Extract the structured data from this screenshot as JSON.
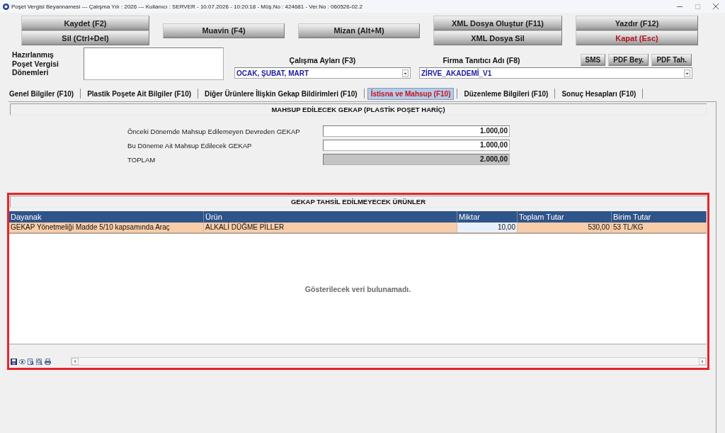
{
  "window": {
    "title": "Poşet Vergisi Beyannamesi --- Çalışma Yılı : 2026 --- Kullanıcı : SERVER - 10.07.2026 - 10:20:18 - Müş.No : 424681 - Ver.No : 060526-02.2"
  },
  "toolbar": {
    "groups": [
      [
        {
          "label": "Kaydet (F2)",
          "kind": "normal"
        },
        {
          "label": "Sil (Ctrl+Del)",
          "kind": "normal"
        }
      ],
      [
        {
          "label": "Muavin (F4)",
          "kind": "normal"
        }
      ],
      [
        {
          "label": "Mizan (Alt+M)",
          "kind": "normal"
        }
      ],
      [
        {
          "label": "XML Dosya Oluştur (F11)",
          "kind": "normal"
        },
        {
          "label": "XML Dosya Sil",
          "kind": "normal"
        }
      ],
      [
        {
          "label": "Yazdır (F12)",
          "kind": "normal"
        },
        {
          "label": "Kapat (Esc)",
          "kind": "danger"
        }
      ]
    ]
  },
  "periods": {
    "label": "Hazırlanmış Poşet Vergisi Dönemleri"
  },
  "work_months": {
    "label": "Çalışma Ayları (F3)",
    "value": "OCAK, ŞUBAT, MART"
  },
  "company": {
    "label": "Firma Tanıtıcı Adı (F8)",
    "value": "ZİRVE_AKADEMİ_V1",
    "buttons": [
      "SMS",
      "PDF Bey.",
      "PDF Tah."
    ]
  },
  "tabs": [
    {
      "label": "Genel Bilgiler (F10)",
      "selected": false
    },
    {
      "label": "Plastik Poşete Ait Bilgiler (F10)",
      "selected": false
    },
    {
      "label": "Diğer Ürünlere İlişkin Gekap Bildirimleri (F10)",
      "selected": false
    },
    {
      "label": "İstisna ve Mahsup (F10)",
      "selected": true
    },
    {
      "label": "Düzenleme Bilgileri (F10)",
      "selected": false
    },
    {
      "label": "Sonuç Hesapları (F10)",
      "selected": false
    }
  ],
  "offset_panel": {
    "title": "MAHSUP EDİLECEK GEKAP (PLASTİK POŞET HARİÇ)",
    "rows": [
      {
        "label": "Önceki Dönemde Mahsup Edilemeyen Devreden GEKAP",
        "value": "1.000,00",
        "readonly": false
      },
      {
        "label": "Bu Döneme Ait Mahsup Edilecek GEKAP",
        "value": "1.000,00",
        "readonly": false
      },
      {
        "label": "TOPLAM",
        "value": "2.000,00",
        "readonly": true
      }
    ]
  },
  "products_panel": {
    "title": "GEKAP TAHSİL EDİLMEYECEK ÜRÜNLER",
    "highlighted": true,
    "columns": [
      {
        "label": "Dayanak",
        "kind": "text"
      },
      {
        "label": "Ürün",
        "kind": "text"
      },
      {
        "label": "Miktar",
        "kind": "number"
      },
      {
        "label": "Toplam Tutar",
        "kind": "number"
      },
      {
        "label": "Birim Tutar",
        "kind": "text"
      }
    ],
    "rows": [
      {
        "selected": true,
        "cells": [
          {
            "text": "GEKAP Yönetmeliği Madde 5/10 kapsamında Araç",
            "focused": false
          },
          {
            "text": "ALKALİ DÜĞME PİLLER",
            "focused": false
          },
          {
            "text": "10,00",
            "focused": true
          },
          {
            "text": "530,00",
            "focused": false
          },
          {
            "text": "53 TL/KG",
            "focused": false
          }
        ]
      }
    ],
    "empty_message": "Gösterilecek veri bulunamadı."
  }
}
